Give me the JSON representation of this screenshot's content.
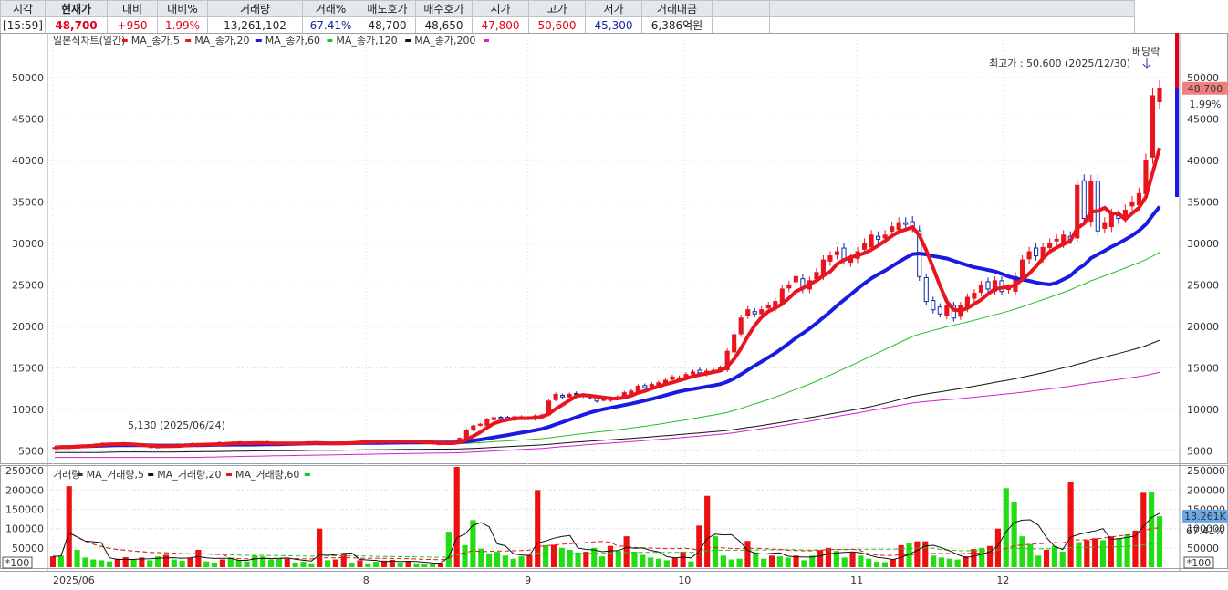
{
  "quote": {
    "headers": [
      "시각",
      "현재가",
      "대비",
      "대비%",
      "거래량",
      "거래%",
      "매도호가",
      "매수호가",
      "시가",
      "고가",
      "저가",
      "거래대금"
    ],
    "values": [
      {
        "text": "[15:59]",
        "color": "#222222"
      },
      {
        "text": "48,700",
        "color": "#e0001a"
      },
      {
        "text": "+950",
        "color": "#e0001a"
      },
      {
        "text": "1.99%",
        "color": "#e0001a"
      },
      {
        "text": "13,261,102",
        "color": "#222222"
      },
      {
        "text": "67.41%",
        "color": "#1028a8"
      },
      {
        "text": "48,700",
        "color": "#222222"
      },
      {
        "text": "48,650",
        "color": "#222222"
      },
      {
        "text": "47,800",
        "color": "#e0001a"
      },
      {
        "text": "50,600",
        "color": "#e0001a"
      },
      {
        "text": "45,300",
        "color": "#1028a8"
      },
      {
        "text": "6,386억원",
        "color": "#222222"
      }
    ]
  },
  "price_legend": [
    {
      "text": "일본식차트(일간)",
      "color": "#333333"
    },
    {
      "text": "MA_종가,5",
      "color": "#e8141e"
    },
    {
      "text": "MA_종가,20",
      "color": "#1a1ae0"
    },
    {
      "text": "MA_종가,60",
      "color": "#22c020"
    },
    {
      "text": "MA_종가,120",
      "color": "#111111"
    },
    {
      "text": "MA_종가,200",
      "color": "#d020d0"
    }
  ],
  "volume_legend": [
    {
      "text": "거래량",
      "color": "#333333"
    },
    {
      "text": "MA_거래량,5",
      "color": "#111111"
    },
    {
      "text": "MA_거래량,20",
      "color": "#e8141e"
    },
    {
      "text": "MA_거래량,60",
      "color": "#22c020"
    }
  ],
  "annotations": {
    "high": "최고가 : 50,600 (2025/12/30)",
    "low": "5,130 (2025/06/24)",
    "ex_dividend": "배당락"
  },
  "price_badges": {
    "price": "48,700",
    "pct": "1.99%"
  },
  "volume_badges": {
    "value": "13.261K",
    "pct": "67.41%"
  },
  "unit_label": "*100",
  "x_labels": [
    {
      "text": "2025/06",
      "x": "2025/06/02"
    },
    {
      "text": "8",
      "x": "2025/08/01"
    },
    {
      "text": "9",
      "x": "2025/09/01"
    },
    {
      "text": "10",
      "x": "2025/10/01"
    },
    {
      "text": "11",
      "x": "2025/11/03"
    },
    {
      "text": "12",
      "x": "2025/12/01"
    }
  ],
  "chart_data": {
    "type": "candlestick",
    "x": [
      "2025/06/02",
      "2025/12/31"
    ],
    "price_axis": {
      "ticks": [
        5000,
        10000,
        15000,
        20000,
        25000,
        30000,
        35000,
        40000,
        45000,
        50000
      ],
      "range": [
        3500,
        54500
      ]
    },
    "volume_axis": {
      "ticks": [
        50000,
        100000,
        150000,
        200000,
        250000
      ],
      "range": [
        0,
        260000
      ],
      "unit": "*100"
    },
    "close": [
      5400,
      5500,
      5450,
      5600,
      5700,
      5650,
      5800,
      5900,
      5800,
      5850,
      5750,
      5700,
      5600,
      5550,
      5500,
      5450,
      5600,
      5650,
      5700,
      5800,
      5750,
      5700,
      5800,
      5900,
      5850,
      5950,
      6000,
      5900,
      5850,
      5950,
      6000,
      5900,
      5800,
      5850,
      5900,
      5950,
      6000,
      5950,
      5900,
      5850,
      5800,
      5900,
      6000,
      6050,
      6100,
      6150,
      6100,
      6050,
      6100,
      6200,
      6150,
      6100,
      6050,
      6000,
      5950,
      5900,
      5850,
      5900,
      6000,
      6500,
      7500,
      8000,
      8200,
      8800,
      9000,
      8900,
      8800,
      9100,
      8900,
      8950,
      9200,
      9300,
      11000,
      11800,
      11500,
      11800,
      11900,
      11600,
      11400,
      11000,
      11200,
      11400,
      11500,
      12000,
      12200,
      12800,
      12600,
      13000,
      13200,
      13500,
      13900,
      13800,
      14200,
      14500,
      14400,
      14600,
      14700,
      15000,
      17000,
      19000,
      21000,
      22000,
      21500,
      22000,
      22500,
      23000,
      24500,
      25000,
      26000,
      24500,
      25500,
      26500,
      28000,
      28500,
      29000,
      28000,
      28200,
      29000,
      30000,
      31000,
      30500,
      31000,
      32000,
      32500,
      32300,
      32000,
      26000,
      23000,
      22000,
      21500,
      22500,
      21000,
      22500,
      23500,
      24000,
      25000,
      24500,
      25500,
      24200,
      24600,
      26000,
      28000,
      29000,
      28500,
      29500,
      30000,
      30500,
      31000,
      30500,
      37000,
      33000,
      37500,
      31500,
      32500,
      33500,
      33000,
      34000,
      35000,
      36000,
      40000,
      47800,
      48700
    ],
    "volume": [
      28000,
      30000,
      210000,
      45000,
      25000,
      20000,
      18000,
      15000,
      22000,
      26000,
      19000,
      25000,
      18000,
      28000,
      32000,
      20000,
      17000,
      24000,
      45000,
      15000,
      12000,
      20000,
      24000,
      18000,
      15000,
      30000,
      28000,
      20000,
      22000,
      22000,
      12000,
      14000,
      10000,
      100000,
      18000,
      20000,
      33000,
      12000,
      18000,
      10000,
      14000,
      17000,
      19000,
      12000,
      15000,
      10000,
      9000,
      8000,
      11000,
      92000,
      260000,
      57000,
      122000,
      48000,
      36000,
      40000,
      30000,
      22000,
      28000,
      32000,
      200000,
      57000,
      58000,
      50000,
      45000,
      38000,
      40000,
      50000,
      28000,
      55000,
      42000,
      80000,
      40000,
      32000,
      25000,
      22000,
      18000,
      25000,
      40000,
      15000,
      108000,
      185000,
      80000,
      30000,
      20000,
      22000,
      68000,
      38000,
      22000,
      30000,
      28000,
      25000,
      30000,
      18000,
      30000,
      44000,
      50000,
      42000,
      25000,
      38000,
      30000,
      22000,
      14000,
      13000,
      20000,
      57000,
      63000,
      67000,
      67000,
      30000,
      25000,
      22000,
      20000,
      28000,
      47000,
      50000,
      55000,
      100000,
      205000,
      170000,
      80000,
      60000,
      30000,
      45000,
      55000,
      40000,
      220000,
      65000,
      70000,
      75000,
      70000,
      80000,
      75000,
      85000,
      95000,
      193000,
      195000,
      132000
    ],
    "bar_color_note": "red=up, green/blue=down"
  }
}
